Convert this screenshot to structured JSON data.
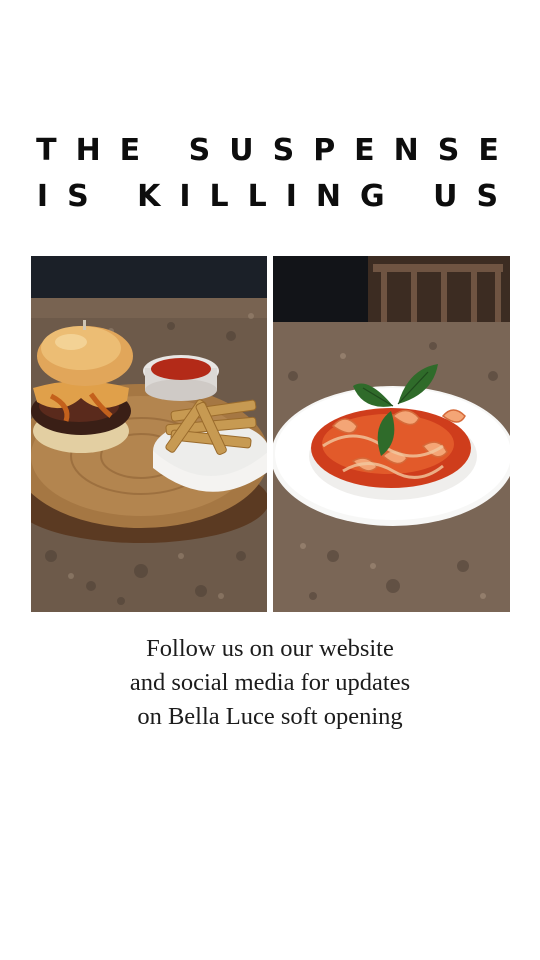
{
  "headline": {
    "line1": "THE SUSPENSE",
    "line2": "IS KILLING US"
  },
  "photos": [
    {
      "subject": "burger with fries and ketchup on wood board"
    },
    {
      "subject": "shrimp pasta with basil in white bowl"
    }
  ],
  "caption": {
    "line1": "Follow us on our website",
    "line2": "and social media for updates",
    "line3": "on Bella Luce soft opening"
  }
}
